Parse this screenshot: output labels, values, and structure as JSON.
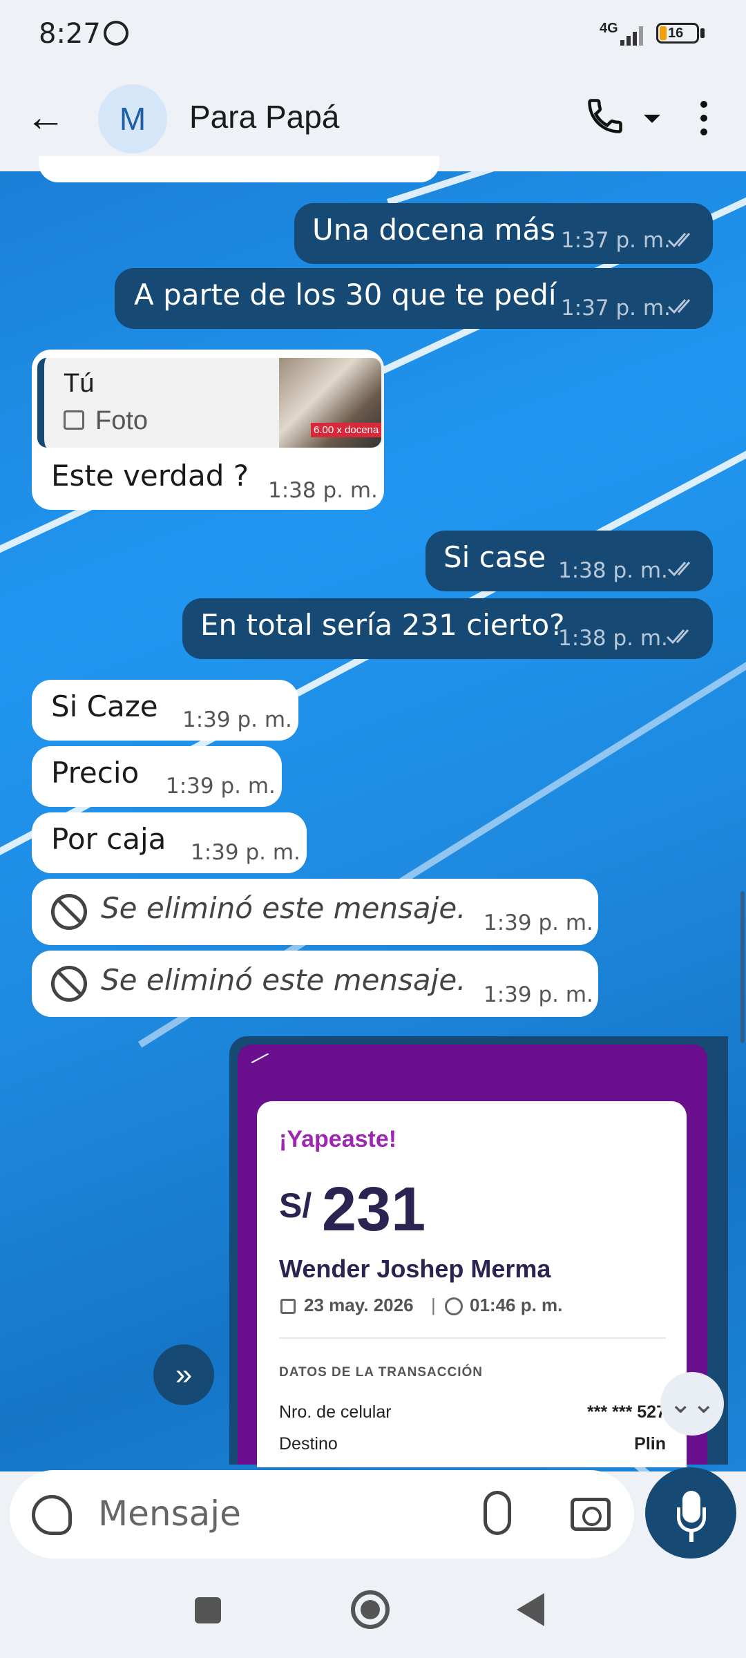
{
  "status_bar": {
    "time": "8:27",
    "network": "4G",
    "battery": "16",
    "icons": [
      "whatsapp-icon",
      "signal-icon",
      "battery-icon"
    ]
  },
  "header": {
    "avatar_letter": "M",
    "contact_name": "Para Papá",
    "icons": [
      "back-arrow-icon",
      "phone-icon",
      "dropdown-icon",
      "more-options-icon"
    ]
  },
  "messages": [
    {
      "dir": "out",
      "text": "Una docena más",
      "time": "1:37 p. m."
    },
    {
      "dir": "out",
      "text": "A parte de los 30 que te pedí",
      "time": "1:37 p. m."
    },
    {
      "dir": "in",
      "quote_author": "Tú",
      "quote_type": "Foto",
      "quote_thumb_tag": "6.00 x docena",
      "text": "Este verdad ?",
      "time": "1:38 p. m."
    },
    {
      "dir": "out",
      "text": "Si case",
      "time": "1:38 p. m."
    },
    {
      "dir": "out",
      "text": "En total sería 231 cierto?",
      "time": "1:38 p. m."
    },
    {
      "dir": "in",
      "text": "Si Caze",
      "time": "1:39 p. m."
    },
    {
      "dir": "in",
      "text": "Precio",
      "time": "1:39 p. m."
    },
    {
      "dir": "in",
      "text": "Por caja",
      "time": "1:39 p. m."
    },
    {
      "dir": "in",
      "deleted": true,
      "text": "Se eliminó este mensaje.",
      "time": "1:39 p. m."
    },
    {
      "dir": "in",
      "deleted": true,
      "text": "Se eliminó este mensaje.",
      "time": "1:39 p. m."
    }
  ],
  "receipt": {
    "title": "¡Yapeaste!",
    "currency": "S/",
    "amount": "231",
    "recipient": "Wender Joshep Merma",
    "date": "23 may. 2026",
    "separator": "|",
    "hour": "01:46 p. m.",
    "section_title": "DATOS DE LA TRANSACCIÓN",
    "rows": [
      {
        "label": "Nro. de celular",
        "value": "*** *** 527"
      },
      {
        "label": "Destino",
        "value": "Plin"
      }
    ]
  },
  "composer": {
    "placeholder": "Mensaje",
    "icons": [
      "sticker-icon",
      "attach-icon",
      "camera-icon",
      "mic-icon"
    ]
  },
  "controls": {
    "forward_icon": "»",
    "scroll_down_icon": "⌄⌄"
  },
  "colors": {
    "outgoing_bubble": "#164a74",
    "incoming_bubble": "#ffffff",
    "yape_purple": "#6a0f8e"
  }
}
